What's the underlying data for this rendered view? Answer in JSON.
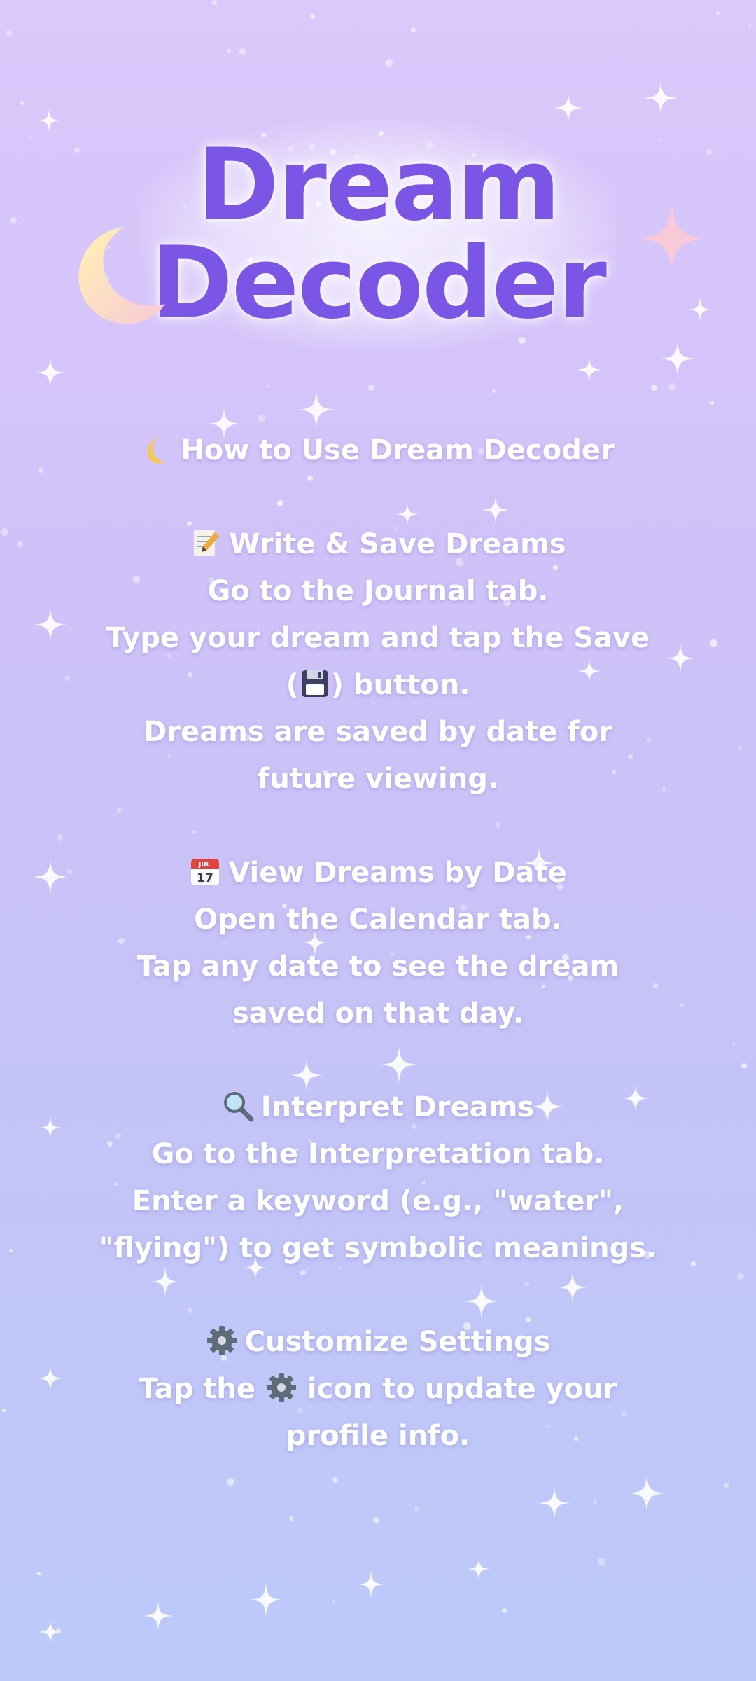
{
  "app": {
    "title_line1": "Dream",
    "title_line2": "Decoder"
  },
  "guide": {
    "heading": "How to Use Dream Decoder",
    "heading_icon": "crescent-moon-icon",
    "sections": [
      {
        "icon": "memo-icon",
        "title": "Write & Save Dreams",
        "lines": [
          "Go to the Journal tab.",
          "Type your dream and tap the Save",
          "button.",
          "Dreams are saved by date for",
          "future viewing."
        ],
        "inline_icon": "floppy-disk-icon"
      },
      {
        "icon": "calendar-icon",
        "title": "View Dreams by Date",
        "calendar_month": "JUL",
        "calendar_day": "17",
        "lines": [
          "Open the Calendar tab.",
          "Tap any date to see the dream",
          "saved on that day."
        ]
      },
      {
        "icon": "magnifier-icon",
        "title": "Interpret Dreams",
        "lines": [
          "Go to the Interpretation tab.",
          "Enter a keyword (e.g., \"water\",",
          "\"flying\") to get symbolic meanings."
        ]
      },
      {
        "icon": "gear-icon",
        "title": "Customize Settings",
        "lines_parts": [
          "Tap the",
          "icon to update your"
        ],
        "lines": [
          "profile info."
        ]
      }
    ]
  },
  "colors": {
    "title": "#7a55e6",
    "text": "#ffffff",
    "bg_top": "#dcc8fb",
    "bg_bottom": "#bccafa"
  }
}
